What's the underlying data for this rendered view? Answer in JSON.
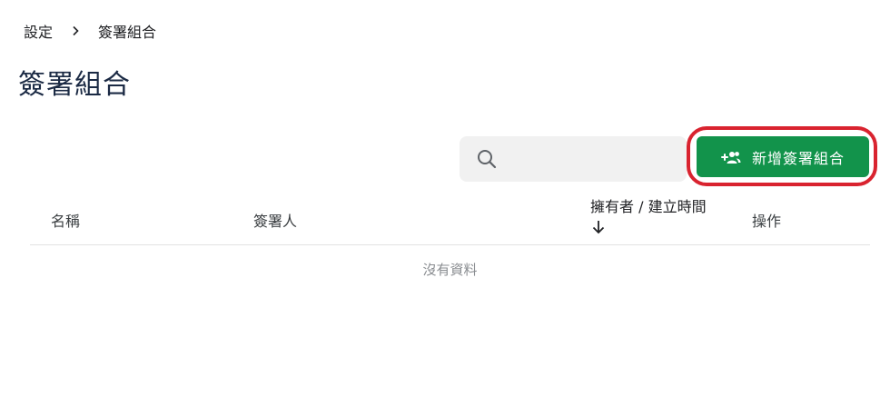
{
  "breadcrumb": {
    "parent": "設定",
    "current": "簽署組合"
  },
  "page": {
    "title": "簽署組合"
  },
  "search": {
    "placeholder": "",
    "value": ""
  },
  "toolbar": {
    "add_label": "新增簽署組合"
  },
  "table": {
    "columns": {
      "name": "名稱",
      "signers": "簽署人",
      "owner_created": "擁有者 / 建立時間",
      "actions": "操作"
    },
    "sort": {
      "column": "owner_created",
      "direction": "descending"
    },
    "empty_text": "沒有資料"
  },
  "colors": {
    "primary_button": "#12934b",
    "highlight_ring": "#d9232f",
    "title": "#1b2a44"
  },
  "icons": {
    "search": "search-icon",
    "add_group": "add-group-icon",
    "chevron": "chevron-right-icon",
    "sort": "arrow-down-icon"
  }
}
